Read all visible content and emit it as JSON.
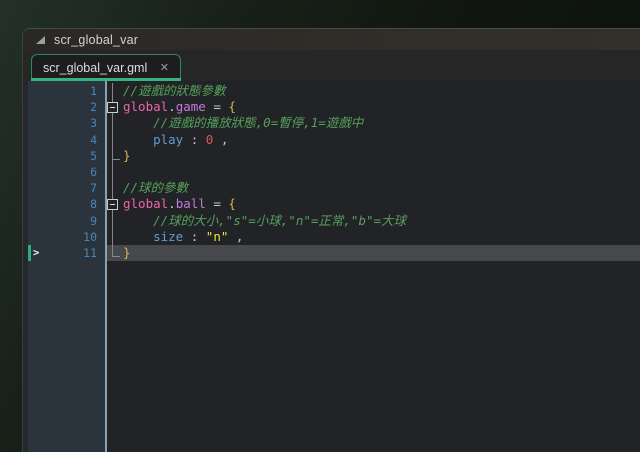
{
  "window": {
    "title": "scr_global_var"
  },
  "tab": {
    "label": "scr_global_var.gml",
    "close_icon": "✕"
  },
  "colors": {
    "accent_green": "#39b27e",
    "tab_border": "#2f8664",
    "indicator_green": "#2fae76",
    "gutter_bg": "#2b333d",
    "line_number": "#4887b6",
    "current_line_bg": "#46484b",
    "code_bg": "#222326",
    "syntax": {
      "comment": "#55a05c",
      "keyword": "#ec64ae",
      "member": "#c678dd",
      "prop": "#5c9fd6",
      "number": "#d25a5a",
      "str": "#e8e83e",
      "brace": "#d7b352",
      "op": "#c8c8c8",
      "plain": "#c8c8c8"
    }
  },
  "editor": {
    "current_line": 11,
    "indicator_line": 11,
    "fold_marker_lines": [
      2,
      8
    ],
    "fold_end_lines": [
      5,
      11
    ],
    "lines": [
      {
        "n": 1,
        "tokens": [
          [
            "comment",
            "//遊戲的狀態參數"
          ]
        ]
      },
      {
        "n": 2,
        "tokens": [
          [
            "keyword",
            "global"
          ],
          [
            "op",
            "."
          ],
          [
            "member",
            "game"
          ],
          [
            "op",
            " = "
          ],
          [
            "brace",
            "{"
          ]
        ]
      },
      {
        "n": 3,
        "tokens": [
          [
            "comment",
            "    //遊戲的播放狀態,0=暫停,1=遊戲中"
          ]
        ]
      },
      {
        "n": 4,
        "tokens": [
          [
            "plain",
            "    "
          ],
          [
            "prop",
            "play"
          ],
          [
            "op",
            " : "
          ],
          [
            "number",
            "0"
          ],
          [
            "op",
            " ,"
          ]
        ]
      },
      {
        "n": 5,
        "tokens": [
          [
            "brace",
            "}"
          ]
        ]
      },
      {
        "n": 6,
        "tokens": []
      },
      {
        "n": 7,
        "tokens": [
          [
            "comment",
            "//球的參數"
          ]
        ]
      },
      {
        "n": 8,
        "tokens": [
          [
            "keyword",
            "global"
          ],
          [
            "op",
            "."
          ],
          [
            "member",
            "ball"
          ],
          [
            "op",
            " = "
          ],
          [
            "brace",
            "{"
          ]
        ]
      },
      {
        "n": 9,
        "tokens": [
          [
            "comment",
            "    //球的大小,\"s\"=小球,\"n\"=正常,\"b\"=大球"
          ]
        ]
      },
      {
        "n": 10,
        "tokens": [
          [
            "plain",
            "    "
          ],
          [
            "prop",
            "size"
          ],
          [
            "op",
            " : "
          ],
          [
            "str",
            "\"n\""
          ],
          [
            "op",
            " ,"
          ]
        ]
      },
      {
        "n": 11,
        "tokens": [
          [
            "brace",
            "}"
          ]
        ]
      }
    ]
  }
}
